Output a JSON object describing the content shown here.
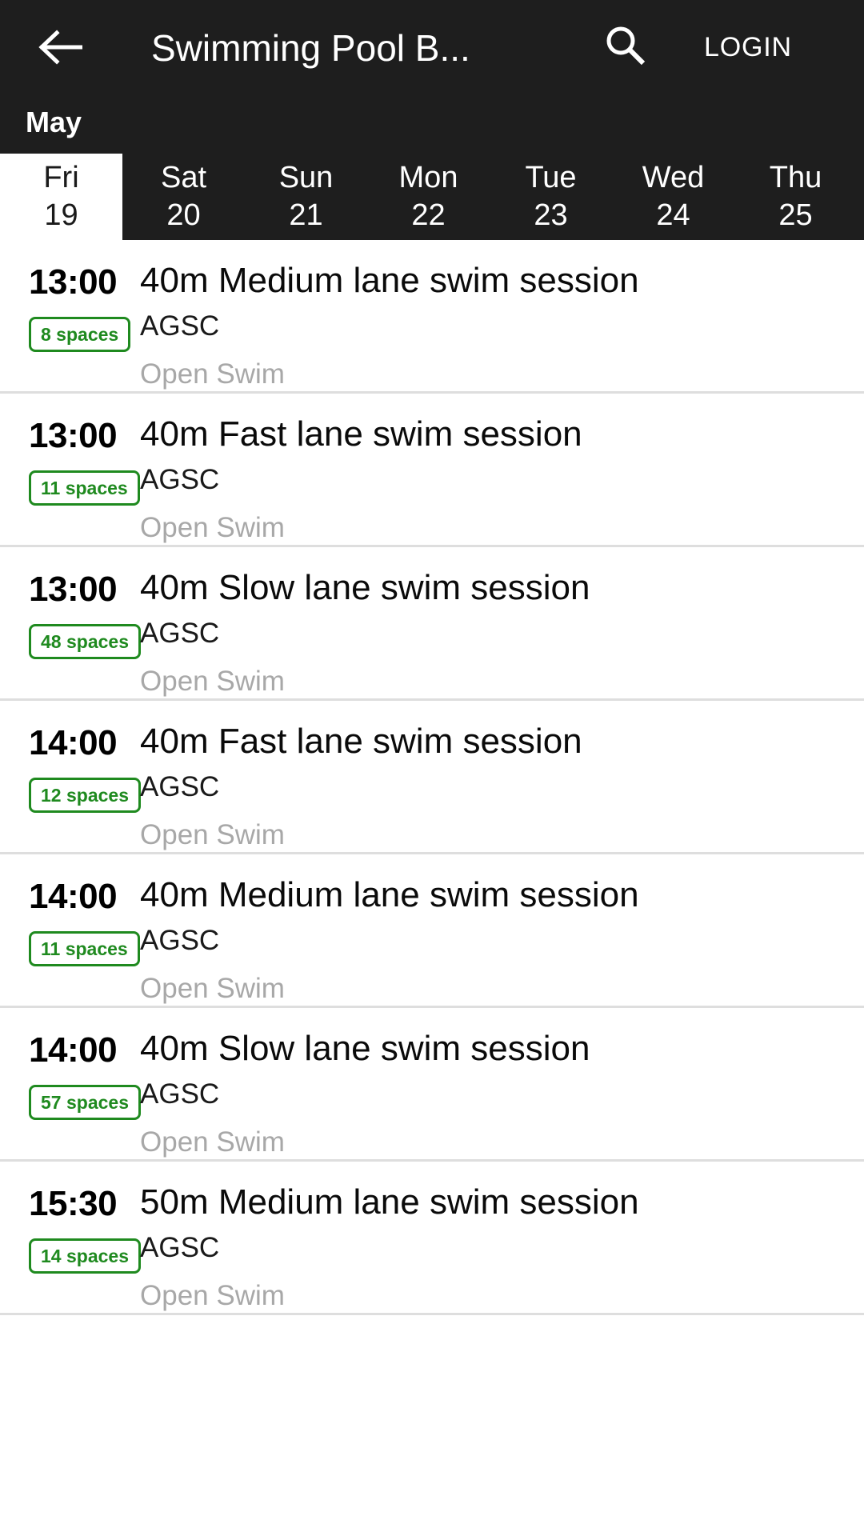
{
  "header": {
    "back_icon": "arrow-left-icon",
    "title": "Swimming Pool B...",
    "search_icon": "search-icon",
    "login_label": "LOGIN",
    "month_label": "May",
    "bg_color": "#1e1e1e"
  },
  "day_tabs": [
    {
      "dow": "Fri",
      "dom": "19",
      "selected": true
    },
    {
      "dow": "Sat",
      "dom": "20",
      "selected": false
    },
    {
      "dow": "Sun",
      "dom": "21",
      "selected": false
    },
    {
      "dow": "Mon",
      "dom": "22",
      "selected": false
    },
    {
      "dow": "Tue",
      "dom": "23",
      "selected": false
    },
    {
      "dow": "Wed",
      "dom": "24",
      "selected": false
    },
    {
      "dow": "Thu",
      "dom": "25",
      "selected": false
    }
  ],
  "sessions": [
    {
      "time": "13:00",
      "spaces": "8 spaces",
      "title": "40m Medium lane swim session",
      "venue": "AGSC",
      "category": "Open Swim"
    },
    {
      "time": "13:00",
      "spaces": "11 spaces",
      "title": "40m Fast lane swim session",
      "venue": "AGSC",
      "category": "Open Swim"
    },
    {
      "time": "13:00",
      "spaces": "48 spaces",
      "title": "40m Slow lane swim session",
      "venue": "AGSC",
      "category": "Open Swim"
    },
    {
      "time": "14:00",
      "spaces": "12 spaces",
      "title": "40m Fast lane swim session",
      "venue": "AGSC",
      "category": "Open Swim"
    },
    {
      "time": "14:00",
      "spaces": "11 spaces",
      "title": "40m Medium lane swim session",
      "venue": "AGSC",
      "category": "Open Swim"
    },
    {
      "time": "14:00",
      "spaces": "57 spaces",
      "title": "40m Slow lane swim session",
      "venue": "AGSC",
      "category": "Open Swim"
    },
    {
      "time": "15:30",
      "spaces": "14 spaces",
      "title": "50m Medium lane swim session",
      "venue": "AGSC",
      "category": "Open Swim"
    }
  ],
  "colors": {
    "badge_green": "#1f8a1f",
    "muted_gray": "#a8a8a8",
    "divider": "#dedede"
  }
}
